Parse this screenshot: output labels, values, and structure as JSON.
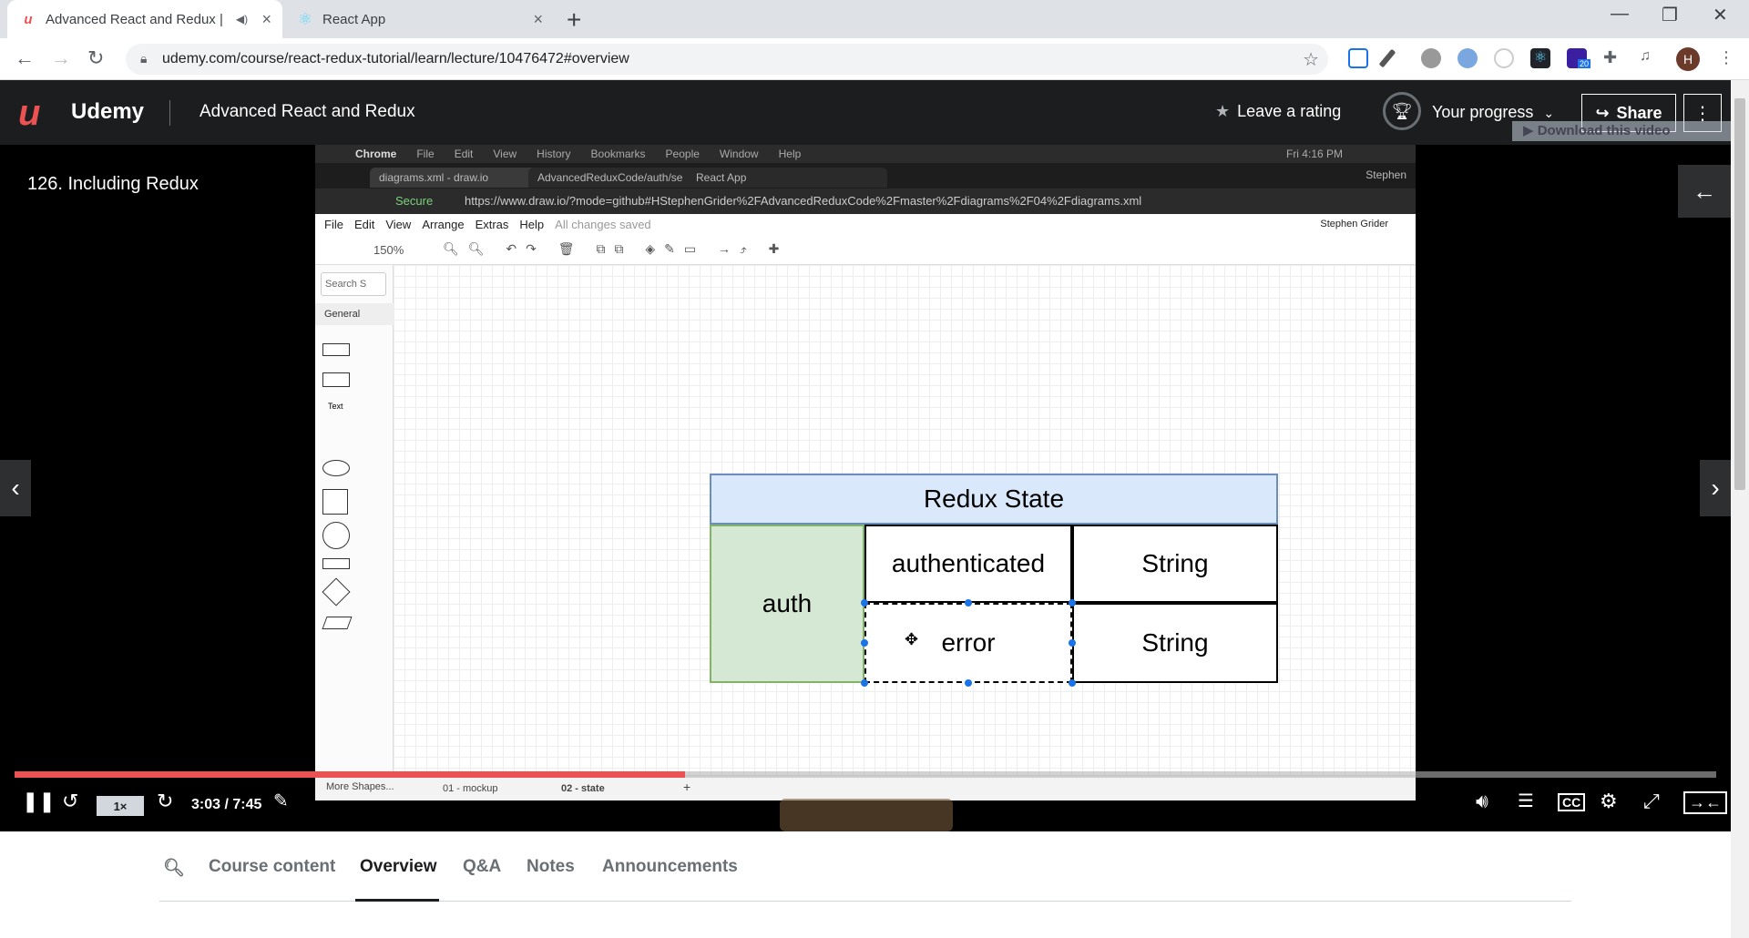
{
  "browser": {
    "tabs": [
      {
        "title": "Advanced React and Redux |",
        "active": true,
        "close": "×"
      },
      {
        "title": "React App",
        "active": false,
        "close": "×"
      }
    ],
    "new_tab": "+",
    "window_controls": {
      "minimize": "—",
      "maximize": "❐",
      "close": "✕"
    },
    "url": "udemy.com/course/react-redux-tutorial/learn/lecture/10476472#overview",
    "profile_initial": "H",
    "extension_badge": "20"
  },
  "header": {
    "brand": "Udemy",
    "course_title": "Advanced React and Redux",
    "rating_label": "Leave a rating",
    "progress_label": "Your progress",
    "share_label": "Share",
    "download_badge": "▶ Download this video"
  },
  "video": {
    "lecture_title": "126. Including Redux",
    "speed": "1×",
    "time": "3:03 / 7:45",
    "progress_fraction": 0.394,
    "recording": {
      "mac_menu": [
        "Chrome",
        "File",
        "Edit",
        "View",
        "History",
        "Bookmarks",
        "People",
        "Window",
        "Help"
      ],
      "mac_clock": "Fri 4:16 PM",
      "user": "Stephen",
      "inner_tabs": [
        "diagrams.xml - draw.io",
        "AdvancedReduxCode/auth/se",
        "React App"
      ],
      "secure_label": "Secure",
      "inner_url": "https://www.draw.io/?mode=github#HStephenGrider%2FAdvancedReduxCode%2Fmaster%2Fdiagrams%2F04%2Fdiagrams.xml",
      "drawio_menu": [
        "File",
        "Edit",
        "View",
        "Arrange",
        "Extras",
        "Help"
      ],
      "save_status": "All changes saved",
      "drawio_user": "Stephen Grider",
      "zoom": "150%",
      "search_placeholder": "Search S",
      "general_label": "General",
      "text_shape_label": "Text",
      "more_shapes": "More Shapes...",
      "pages": [
        "01 - mockup",
        "02 - state"
      ],
      "diagram": {
        "title": "Redux State",
        "group": "auth",
        "rows": [
          {
            "key": "authenticated",
            "type": "String"
          },
          {
            "key": "error",
            "type": "String"
          }
        ]
      }
    }
  },
  "course_tabs": [
    "Course content",
    "Overview",
    "Q&A",
    "Notes",
    "Announcements"
  ],
  "active_course_tab": "Overview",
  "colors": {
    "brand": "#ec5252",
    "header_bg": "#1c1d1f",
    "diagram_title_bg": "#dae8fc",
    "diagram_group_bg": "#d5e8d4",
    "selection": "#1a73e8"
  }
}
